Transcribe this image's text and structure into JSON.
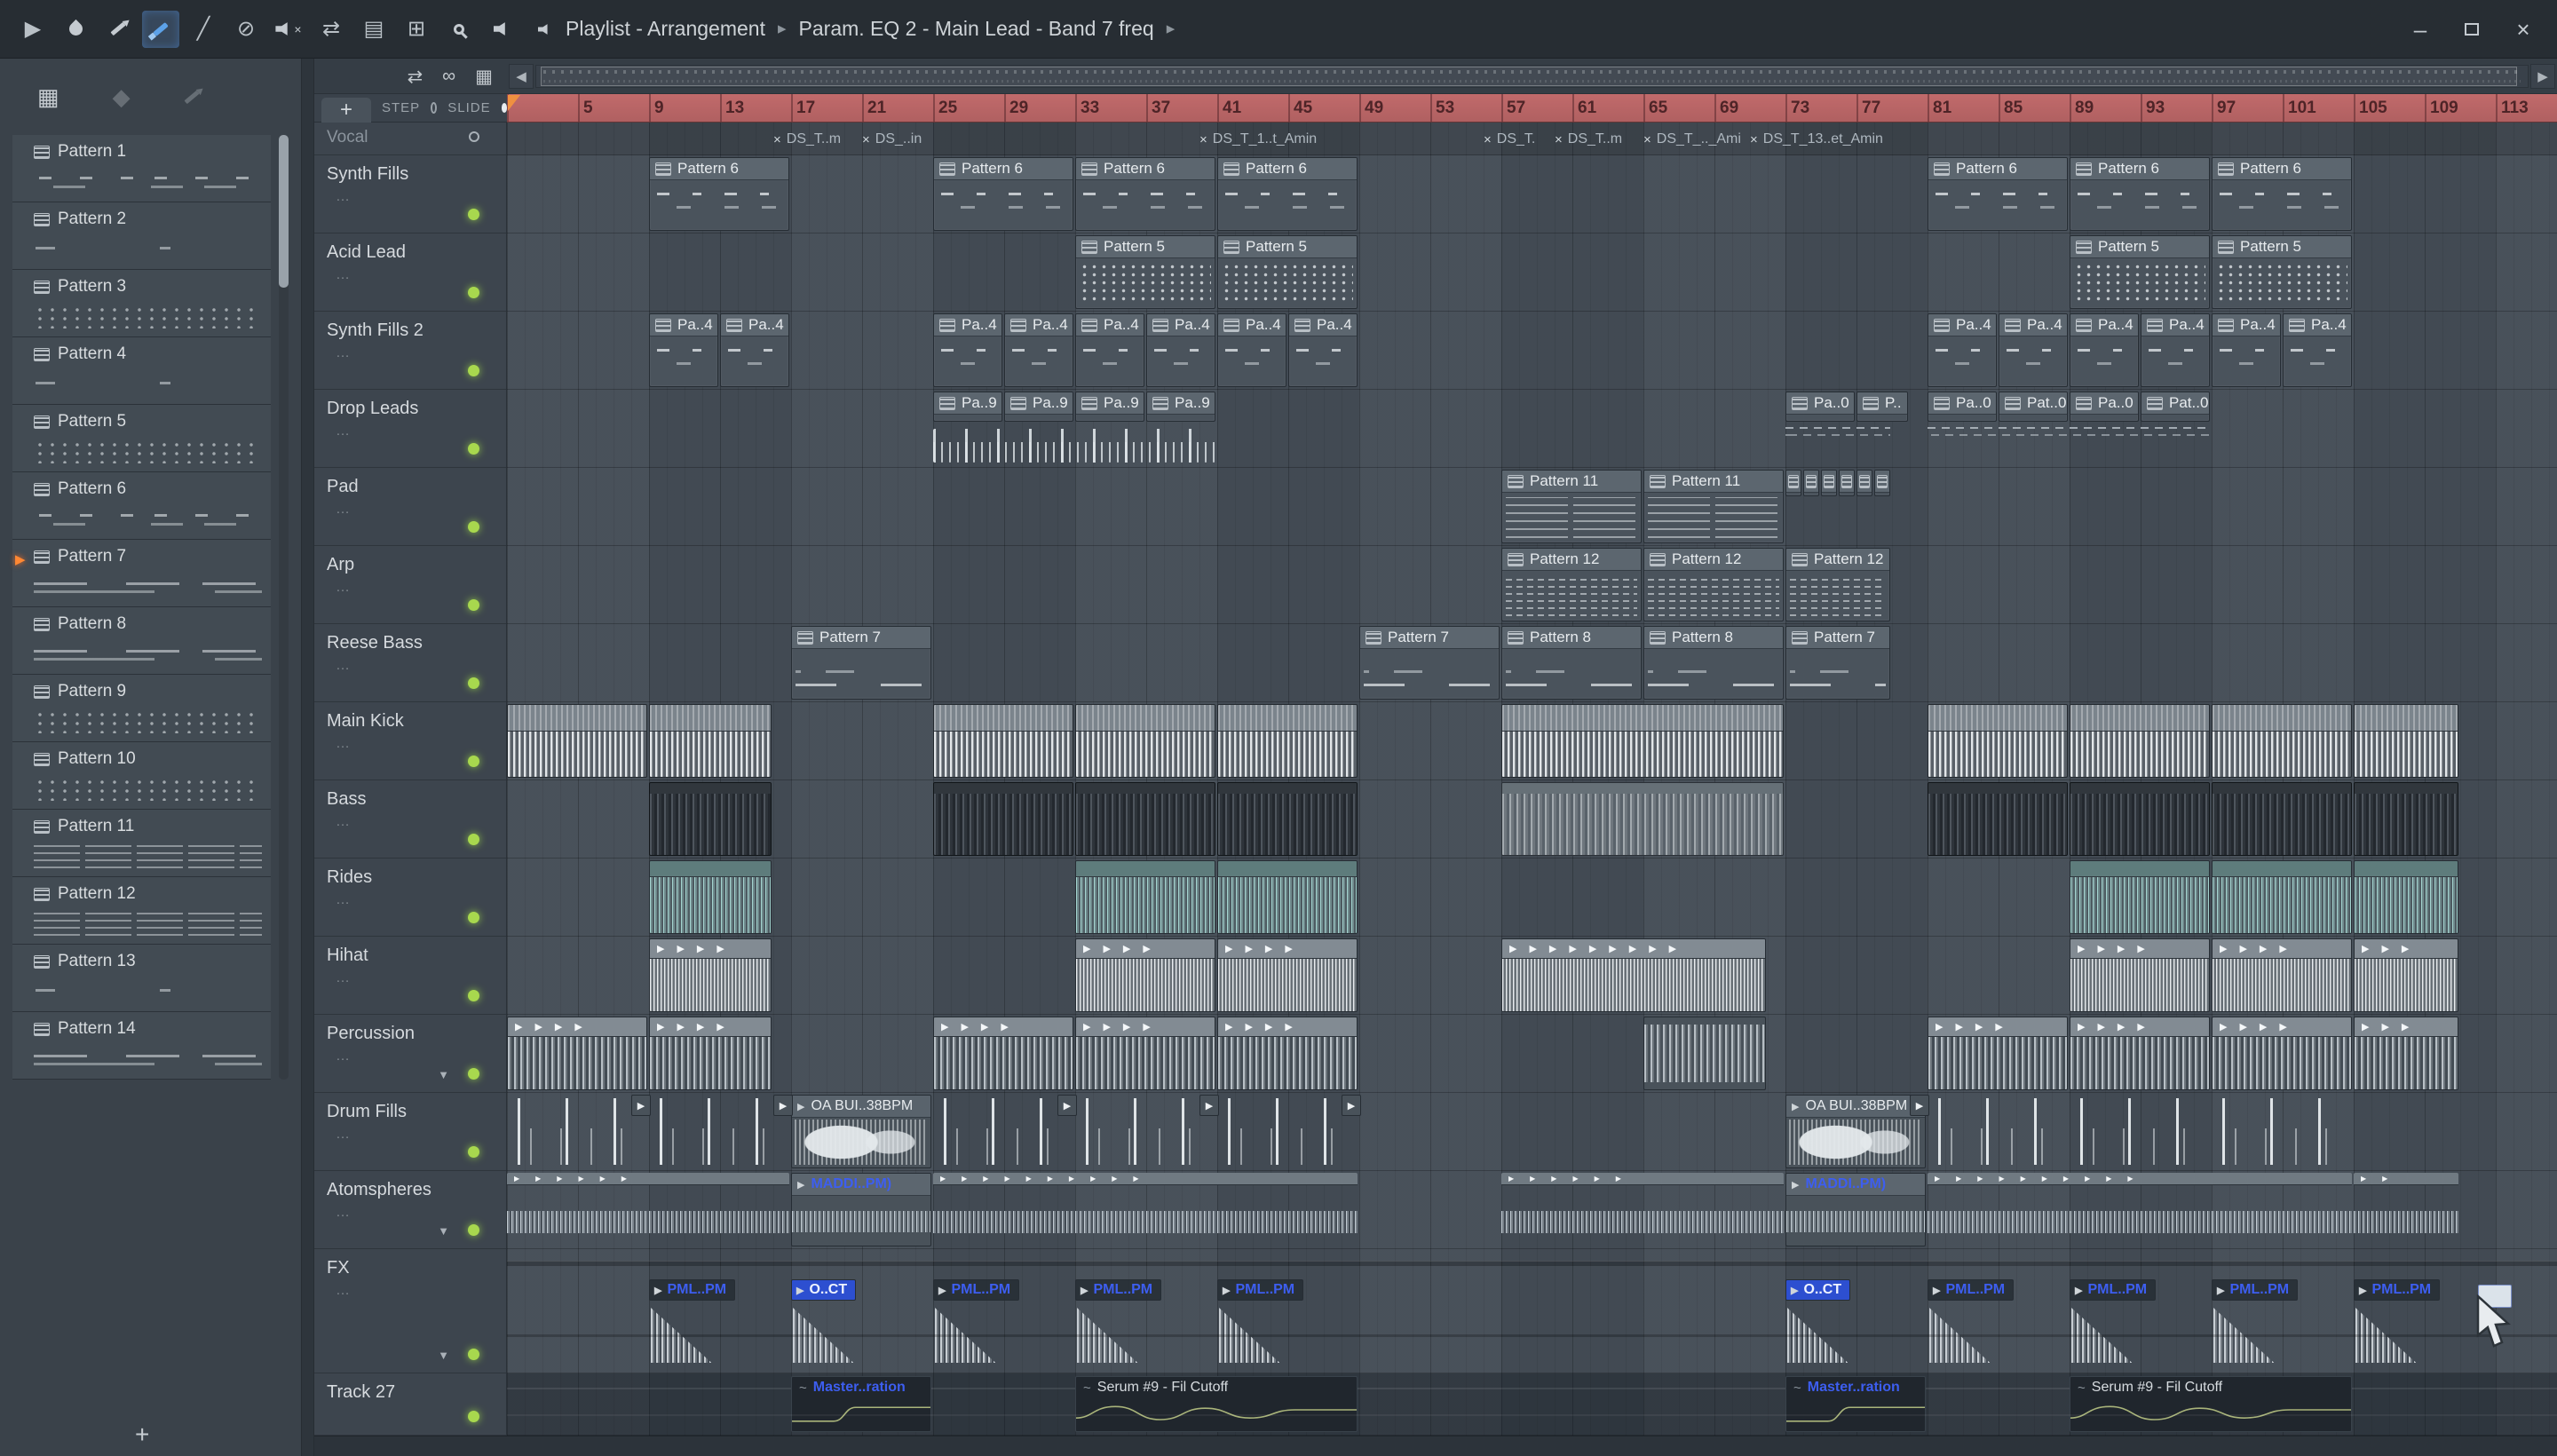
{
  "colors": {
    "led-green": "#a8d84e",
    "timeline-red": "#c16a6b",
    "blue-label": "#3d5ef0",
    "teal-wave": "#a4d4d0",
    "accent-orange": "#ef9040"
  },
  "titlebar": {
    "title_left": "Playlist - Arrangement",
    "title_right": "Param. EQ 2 - Main Lead - Band 7 freq",
    "separator": "▸",
    "tools": [
      {
        "name": "play-icon",
        "glyph": "▶"
      },
      {
        "name": "fl-logo-icon",
        "shape": "fl"
      },
      {
        "name": "draw-tool-icon",
        "shape": "pencil"
      },
      {
        "name": "paint-tool-icon",
        "shape": "brush",
        "active": true
      },
      {
        "name": "slip-tool-icon",
        "glyph": "╱"
      },
      {
        "name": "mute-tool-icon",
        "glyph": "⊘"
      },
      {
        "name": "playback-mute-icon",
        "shape": "speaker-x"
      },
      {
        "name": "swap-channels-icon",
        "glyph": "⇄"
      },
      {
        "name": "stamp-tool-icon",
        "glyph": "▤"
      },
      {
        "name": "zoom-tool-icon",
        "glyph": "⊞"
      },
      {
        "name": "magnifier-icon",
        "shape": "mag"
      },
      {
        "name": "preview-speaker-icon",
        "shape": "speaker"
      }
    ],
    "window_buttons": [
      {
        "name": "minimize-button",
        "glyph": "–"
      },
      {
        "name": "maximize-button",
        "shape": "box"
      },
      {
        "name": "close-button",
        "glyph": "×"
      }
    ]
  },
  "pattern_panel": {
    "icons": [
      {
        "name": "picker-patterns-icon",
        "glyph": "▦"
      },
      {
        "name": "picker-audio-icon",
        "glyph": "◆",
        "dim": true
      },
      {
        "name": "picker-automation-icon",
        "shape": "pencil",
        "dim": true
      }
    ],
    "playing_index": 6,
    "add_button": "+",
    "patterns": [
      {
        "name": "Pattern 1",
        "preview": "dashes"
      },
      {
        "name": "Pattern 2",
        "preview": "sparse"
      },
      {
        "name": "Pattern 3",
        "preview": "dots"
      },
      {
        "name": "Pattern 4",
        "preview": "sparse"
      },
      {
        "name": "Pattern 5",
        "preview": "dots"
      },
      {
        "name": "Pattern 6",
        "preview": "dashes"
      },
      {
        "name": "Pattern 7",
        "preview": "lines"
      },
      {
        "name": "Pattern 8",
        "preview": "lines"
      },
      {
        "name": "Pattern 9",
        "preview": "dots"
      },
      {
        "name": "Pattern 10",
        "preview": "dots"
      },
      {
        "name": "Pattern 11",
        "preview": "chords"
      },
      {
        "name": "Pattern 12",
        "preview": "chords"
      },
      {
        "name": "Pattern 13",
        "preview": "sparse"
      },
      {
        "name": "Pattern 14",
        "preview": "lines"
      }
    ]
  },
  "playlist": {
    "header": {
      "add_button": "+",
      "step_label": "STEP",
      "slide_label": "SLIDE",
      "icons": [
        {
          "name": "move-tool-icon",
          "glyph": "⇄"
        },
        {
          "name": "link-clips-icon",
          "glyph": "∞"
        },
        {
          "name": "grid-snap-icon",
          "glyph": "▦"
        }
      ]
    },
    "ruler": {
      "numbers": [
        5,
        9,
        13,
        17,
        21,
        25,
        29,
        33,
        37,
        41,
        45,
        49,
        53,
        57,
        61,
        65,
        69,
        73,
        77,
        81,
        85,
        89,
        93,
        97,
        101,
        105,
        109,
        113
      ]
    },
    "vocal_track": {
      "name": "Vocal",
      "markers": [
        {
          "bar": 16,
          "label": "DS_T..m"
        },
        {
          "bar": 21,
          "label": "DS_..in"
        },
        {
          "bar": 40,
          "label": "DS_T_1..t_Amin"
        },
        {
          "bar": 56,
          "label": "DS_T."
        },
        {
          "bar": 60,
          "label": "DS_T..m"
        },
        {
          "bar": 65,
          "label": "DS_T_.._Ami"
        },
        {
          "bar": 71,
          "label": "DS_T_13..et_Amin"
        }
      ]
    },
    "tracks": [
      {
        "name": "Synth Fills"
      },
      {
        "name": "Acid Lead"
      },
      {
        "name": "Synth Fills 2"
      },
      {
        "name": "Drop Leads"
      },
      {
        "name": "Pad"
      },
      {
        "name": "Arp"
      },
      {
        "name": "Reese Bass"
      },
      {
        "name": "Main Kick"
      },
      {
        "name": "Bass"
      },
      {
        "name": "Rides"
      },
      {
        "name": "Hihat"
      },
      {
        "name": "Percussion",
        "collapsible": true
      },
      {
        "name": "Drum Fills"
      },
      {
        "name": "Atomspheres",
        "collapsible": true
      },
      {
        "name": "FX",
        "collapsible": true,
        "tall": true
      },
      {
        "name": "Track 27",
        "short": true
      }
    ],
    "clips": [
      {
        "t": 0,
        "k": "pat",
        "n": "Pattern 6",
        "p": "notes",
        "s": 9,
        "l": 8
      },
      {
        "t": 0,
        "k": "pat",
        "n": "Pattern 6",
        "p": "notes",
        "s": 25,
        "l": 8
      },
      {
        "t": 0,
        "k": "pat",
        "n": "Pattern 6",
        "p": "notes",
        "s": 33,
        "l": 8
      },
      {
        "t": 0,
        "k": "pat",
        "n": "Pattern 6",
        "p": "notes",
        "s": 41,
        "l": 8
      },
      {
        "t": 0,
        "k": "pat",
        "n": "Pattern 6",
        "p": "notes",
        "s": 81,
        "l": 8
      },
      {
        "t": 0,
        "k": "pat",
        "n": "Pattern 6",
        "p": "notes",
        "s": 89,
        "l": 8
      },
      {
        "t": 0,
        "k": "pat",
        "n": "Pattern 6",
        "p": "notes",
        "s": 97,
        "l": 8
      },
      {
        "t": 1,
        "k": "pat",
        "n": "Pattern 5",
        "p": "dots",
        "s": 33,
        "l": 8
      },
      {
        "t": 1,
        "k": "pat",
        "n": "Pattern 5",
        "p": "dots",
        "s": 41,
        "l": 8
      },
      {
        "t": 1,
        "k": "pat",
        "n": "Pattern 5",
        "p": "dots",
        "s": 89,
        "l": 8
      },
      {
        "t": 1,
        "k": "pat",
        "n": "Pattern 5",
        "p": "dots",
        "s": 97,
        "l": 8
      },
      {
        "t": 2,
        "k": "pat",
        "n": "Pa..4",
        "p": "notes",
        "s": 9,
        "l": 4
      },
      {
        "t": 2,
        "k": "pat",
        "n": "Pa..4",
        "p": "notes",
        "s": 13,
        "l": 4
      },
      {
        "t": 2,
        "k": "pat",
        "n": "Pa..4",
        "p": "notes",
        "s": 25,
        "l": 4
      },
      {
        "t": 2,
        "k": "pat",
        "n": "Pa..4",
        "p": "notes",
        "s": 29,
        "l": 4
      },
      {
        "t": 2,
        "k": "pat",
        "n": "Pa..4",
        "p": "notes",
        "s": 33,
        "l": 4
      },
      {
        "t": 2,
        "k": "pat",
        "n": "Pa..4",
        "p": "notes",
        "s": 37,
        "l": 4
      },
      {
        "t": 2,
        "k": "pat",
        "n": "Pa..4",
        "p": "notes",
        "s": 41,
        "l": 4
      },
      {
        "t": 2,
        "k": "pat",
        "n": "Pa..4",
        "p": "notes",
        "s": 45,
        "l": 4
      },
      {
        "t": 2,
        "k": "pat",
        "n": "Pa..4",
        "p": "notes",
        "s": 81,
        "l": 4
      },
      {
        "t": 2,
        "k": "pat",
        "n": "Pa..4",
        "p": "notes",
        "s": 85,
        "l": 4
      },
      {
        "t": 2,
        "k": "pat",
        "n": "Pa..4",
        "p": "notes",
        "s": 89,
        "l": 4
      },
      {
        "t": 2,
        "k": "pat",
        "n": "Pa..4",
        "p": "notes",
        "s": 93,
        "l": 4
      },
      {
        "t": 2,
        "k": "pat",
        "n": "Pa..4",
        "p": "notes",
        "s": 97,
        "l": 4
      },
      {
        "t": 2,
        "k": "pat",
        "n": "Pa..4",
        "p": "notes",
        "s": 101,
        "l": 4
      },
      {
        "t": 3,
        "k": "pathdr",
        "n": "Pa..9",
        "s": 25,
        "l": 4
      },
      {
        "t": 3,
        "k": "pathdr",
        "n": "Pa..9",
        "s": 29,
        "l": 4
      },
      {
        "t": 3,
        "k": "pathdr",
        "n": "Pa..9",
        "s": 33,
        "l": 4
      },
      {
        "t": 3,
        "k": "pathdr",
        "n": "Pa..9",
        "s": 37,
        "l": 4
      },
      {
        "t": 3,
        "k": "tickrow",
        "s": 25,
        "l": 16
      },
      {
        "t": 3,
        "k": "pathdr",
        "n": "Pa..0",
        "s": 73,
        "l": 4
      },
      {
        "t": 3,
        "k": "pathdr",
        "n": "P..",
        "s": 77,
        "l": 3
      },
      {
        "t": 3,
        "k": "pathdr",
        "n": "Pa..0",
        "s": 81,
        "l": 4
      },
      {
        "t": 3,
        "k": "pathdr",
        "n": "Pat..0",
        "s": 85,
        "l": 4
      },
      {
        "t": 3,
        "k": "pathdr",
        "n": "Pa..0",
        "s": 89,
        "l": 4
      },
      {
        "t": 3,
        "k": "pathdr",
        "n": "Pat..0",
        "s": 93,
        "l": 4
      },
      {
        "t": 3,
        "k": "dashrow",
        "s": 73,
        "l": 6
      },
      {
        "t": 3,
        "k": "dashrow",
        "s": 81,
        "l": 16
      },
      {
        "t": 4,
        "k": "pat",
        "n": "Pattern 11",
        "p": "chords",
        "s": 57,
        "l": 8
      },
      {
        "t": 4,
        "k": "pat",
        "n": "Pattern 11",
        "p": "chords",
        "s": 65,
        "l": 8
      },
      {
        "t": 4,
        "k": "tiny",
        "s": 73,
        "l": 1
      },
      {
        "t": 4,
        "k": "tiny",
        "s": 74,
        "l": 1
      },
      {
        "t": 4,
        "k": "tiny",
        "s": 75,
        "l": 1
      },
      {
        "t": 4,
        "k": "tiny",
        "s": 76,
        "l": 1
      },
      {
        "t": 4,
        "k": "tiny",
        "s": 77,
        "l": 1
      },
      {
        "t": 4,
        "k": "tiny",
        "s": 78,
        "l": 1
      },
      {
        "t": 5,
        "k": "pat",
        "n": "Pattern 12",
        "p": "arp",
        "s": 57,
        "l": 8
      },
      {
        "t": 5,
        "k": "pat",
        "n": "Pattern 12",
        "p": "arp",
        "s": 65,
        "l": 8
      },
      {
        "t": 5,
        "k": "pat",
        "n": "Pattern 12",
        "p": "arp",
        "s": 73,
        "l": 6
      },
      {
        "t": 6,
        "k": "pat",
        "n": "Pattern 7",
        "p": "bass",
        "s": 17,
        "l": 8
      },
      {
        "t": 6,
        "k": "pat",
        "n": "Pattern 7",
        "p": "bass",
        "s": 49,
        "l": 8
      },
      {
        "t": 6,
        "k": "pat",
        "n": "Pattern 8",
        "p": "bass",
        "s": 57,
        "l": 8
      },
      {
        "t": 6,
        "k": "pat",
        "n": "Pattern 8",
        "p": "bass",
        "s": 65,
        "l": 8
      },
      {
        "t": 6,
        "k": "pat",
        "n": "Pattern 7",
        "p": "bass",
        "s": 73,
        "l": 6
      },
      {
        "t": 7,
        "k": "kick",
        "s": 1,
        "l": 8
      },
      {
        "t": 7,
        "k": "kick",
        "s": 9,
        "l": 7
      },
      {
        "t": 7,
        "k": "kick",
        "s": 25,
        "l": 8
      },
      {
        "t": 7,
        "k": "kick",
        "s": 33,
        "l": 8
      },
      {
        "t": 7,
        "k": "kick",
        "s": 41,
        "l": 8
      },
      {
        "t": 7,
        "k": "kick",
        "s": 57,
        "l": 16
      },
      {
        "t": 7,
        "k": "kick",
        "s": 81,
        "l": 8
      },
      {
        "t": 7,
        "k": "kick",
        "s": 89,
        "l": 8
      },
      {
        "t": 7,
        "k": "kick",
        "s": 97,
        "l": 8
      },
      {
        "t": 7,
        "k": "kick",
        "s": 105,
        "l": 6
      },
      {
        "t": 8,
        "k": "bass",
        "s": 9,
        "l": 7
      },
      {
        "t": 8,
        "k": "bass",
        "s": 25,
        "l": 8
      },
      {
        "t": 8,
        "k": "bass",
        "s": 33,
        "l": 8
      },
      {
        "t": 8,
        "k": "bass",
        "s": 41,
        "l": 8
      },
      {
        "t": 8,
        "k": "bass2",
        "s": 57,
        "l": 16
      },
      {
        "t": 8,
        "k": "bass",
        "s": 81,
        "l": 8
      },
      {
        "t": 8,
        "k": "bass",
        "s": 89,
        "l": 8
      },
      {
        "t": 8,
        "k": "bass",
        "s": 97,
        "l": 8
      },
      {
        "t": 8,
        "k": "bass",
        "s": 105,
        "l": 6
      },
      {
        "t": 9,
        "k": "ride",
        "s": 9,
        "l": 7
      },
      {
        "t": 9,
        "k": "ride",
        "s": 33,
        "l": 8
      },
      {
        "t": 9,
        "k": "ride",
        "s": 41,
        "l": 8
      },
      {
        "t": 9,
        "k": "ride",
        "s": 89,
        "l": 8
      },
      {
        "t": 9,
        "k": "ride",
        "s": 97,
        "l": 8
      },
      {
        "t": 9,
        "k": "ride",
        "s": 105,
        "l": 6
      },
      {
        "t": 10,
        "k": "hat",
        "s": 9,
        "l": 7
      },
      {
        "t": 10,
        "k": "hat",
        "s": 33,
        "l": 8
      },
      {
        "t": 10,
        "k": "hat",
        "s": 41,
        "l": 8
      },
      {
        "t": 10,
        "k": "hatlong",
        "s": 57,
        "l": 15
      },
      {
        "t": 10,
        "k": "hat",
        "s": 89,
        "l": 8
      },
      {
        "t": 10,
        "k": "hat",
        "s": 97,
        "l": 8
      },
      {
        "t": 10,
        "k": "hat",
        "s": 105,
        "l": 6
      },
      {
        "t": 11,
        "k": "perc",
        "s": 1,
        "l": 8
      },
      {
        "t": 11,
        "k": "perc",
        "s": 9,
        "l": 7
      },
      {
        "t": 11,
        "k": "perc",
        "s": 25,
        "l": 8
      },
      {
        "t": 11,
        "k": "perc",
        "s": 33,
        "l": 8
      },
      {
        "t": 11,
        "k": "perc",
        "s": 41,
        "l": 8
      },
      {
        "t": 11,
        "k": "wave",
        "s": 65,
        "l": 7
      },
      {
        "t": 11,
        "k": "perc",
        "s": 81,
        "l": 8
      },
      {
        "t": 11,
        "k": "perc",
        "s": 89,
        "l": 8
      },
      {
        "t": 11,
        "k": "perc",
        "s": 97,
        "l": 8
      },
      {
        "t": 11,
        "k": "perc",
        "s": 105,
        "l": 6
      },
      {
        "t": 12,
        "k": "fill",
        "s": 1,
        "l": 8
      },
      {
        "t": 12,
        "k": "fill",
        "s": 9,
        "l": 7
      },
      {
        "t": 12,
        "k": "oabui",
        "n": "OA BUI..38BPM",
        "s": 17,
        "l": 8
      },
      {
        "t": 12,
        "k": "fill",
        "s": 25,
        "l": 8
      },
      {
        "t": 12,
        "k": "fill",
        "s": 33,
        "l": 8
      },
      {
        "t": 12,
        "k": "fill",
        "s": 41,
        "l": 8
      },
      {
        "t": 12,
        "k": "oabui",
        "n": "OA BUI..38BPM",
        "s": 73,
        "l": 8
      },
      {
        "t": 12,
        "k": "fill",
        "s": 81,
        "l": 8
      },
      {
        "t": 12,
        "k": "fill",
        "s": 89,
        "l": 8
      },
      {
        "t": 12,
        "k": "fill",
        "s": 97,
        "l": 8
      },
      {
        "t": 12,
        "k": "miniarrow",
        "s": 8,
        "l": 1
      },
      {
        "t": 12,
        "k": "miniarrow",
        "s": 16,
        "l": 1
      },
      {
        "t": 12,
        "k": "miniarrow",
        "s": 32,
        "l": 1
      },
      {
        "t": 12,
        "k": "miniarrow",
        "s": 40,
        "l": 1
      },
      {
        "t": 12,
        "k": "miniarrow",
        "s": 48,
        "l": 1
      },
      {
        "t": 12,
        "k": "miniarrow",
        "s": 80,
        "l": 1
      },
      {
        "t": 13,
        "k": "atmo",
        "s": 1,
        "l": 16
      },
      {
        "t": 13,
        "k": "atmolabel",
        "n": "MADDI..PM)",
        "s": 17,
        "l": 8
      },
      {
        "t": 13,
        "k": "atmo",
        "s": 25,
        "l": 24
      },
      {
        "t": 13,
        "k": "atmo",
        "s": 57,
        "l": 16
      },
      {
        "t": 13,
        "k": "atmolabel",
        "n": "MADDI..PM)",
        "s": 73,
        "l": 8
      },
      {
        "t": 13,
        "k": "atmo",
        "s": 81,
        "l": 24
      },
      {
        "t": 13,
        "k": "atmo",
        "s": 105,
        "l": 6
      },
      {
        "t": 14,
        "k": "fx",
        "n": "PML..PM",
        "s": 9,
        "l": 6
      },
      {
        "t": 14,
        "k": "fxcyan",
        "n": "O..CT",
        "s": 17,
        "l": 6
      },
      {
        "t": 14,
        "k": "fx",
        "n": "PML..PM",
        "s": 25,
        "l": 6
      },
      {
        "t": 14,
        "k": "fx",
        "n": "PML..PM",
        "s": 33,
        "l": 6
      },
      {
        "t": 14,
        "k": "fx",
        "n": "PML..PM",
        "s": 41,
        "l": 6
      },
      {
        "t": 14,
        "k": "fxcyan",
        "n": "O..CT",
        "s": 73,
        "l": 6
      },
      {
        "t": 14,
        "k": "fx",
        "n": "PML..PM",
        "s": 81,
        "l": 6
      },
      {
        "t": 14,
        "k": "fx",
        "n": "PML..PM",
        "s": 89,
        "l": 6
      },
      {
        "t": 14,
        "k": "fx",
        "n": "PML..PM",
        "s": 97,
        "l": 6
      },
      {
        "t": 14,
        "k": "fx",
        "n": "PML..PM",
        "s": 105,
        "l": 6
      },
      {
        "t": 14,
        "k": "fxend",
        "s": 112,
        "l": 2
      },
      {
        "t": 15,
        "k": "auto",
        "n": "Master..ration",
        "v": "blue",
        "s": 17,
        "l": 8
      },
      {
        "t": 15,
        "k": "auto",
        "n": "Serum #9 - Fil Cutoff",
        "v": "white",
        "s": 33,
        "l": 16
      },
      {
        "t": 15,
        "k": "auto",
        "n": "Master..ration",
        "v": "blue",
        "s": 73,
        "l": 8
      },
      {
        "t": 15,
        "k": "auto",
        "n": "Serum #9 - Fil Cutoff",
        "v": "white",
        "s": 89,
        "l": 16
      }
    ]
  }
}
